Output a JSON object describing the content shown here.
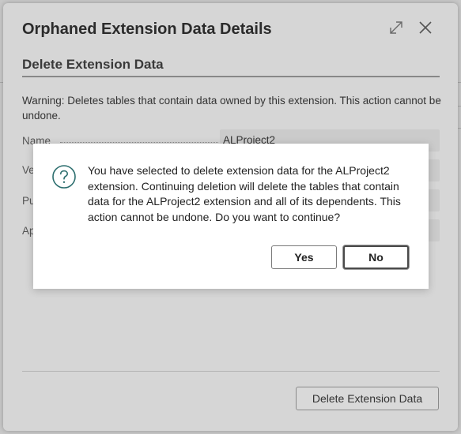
{
  "dialog": {
    "title": "Orphaned Extension Data Details",
    "section_title": "Delete Extension Data",
    "warning": "Warning: Deletes tables that contain data owned by this extension. This action cannot be undone.",
    "fields": [
      {
        "label": "Name",
        "value": "ALProject2"
      },
      {
        "label": "Ve",
        "value": ""
      },
      {
        "label": "Pu",
        "value": ""
      },
      {
        "label": "Ap",
        "value": ""
      }
    ],
    "delete_button": "Delete Extension Data",
    "icons": {
      "expand": "expand-icon",
      "close": "close-icon"
    }
  },
  "confirm": {
    "message": "You have selected to delete extension data for the ALProject2 extension. Continuing deletion will delete the tables that contain data for the ALProject2 extension and all of its dependents. This action cannot be undone. Do you want to continue?",
    "yes_label": "Yes",
    "no_label": "No",
    "icon": "question-icon"
  }
}
